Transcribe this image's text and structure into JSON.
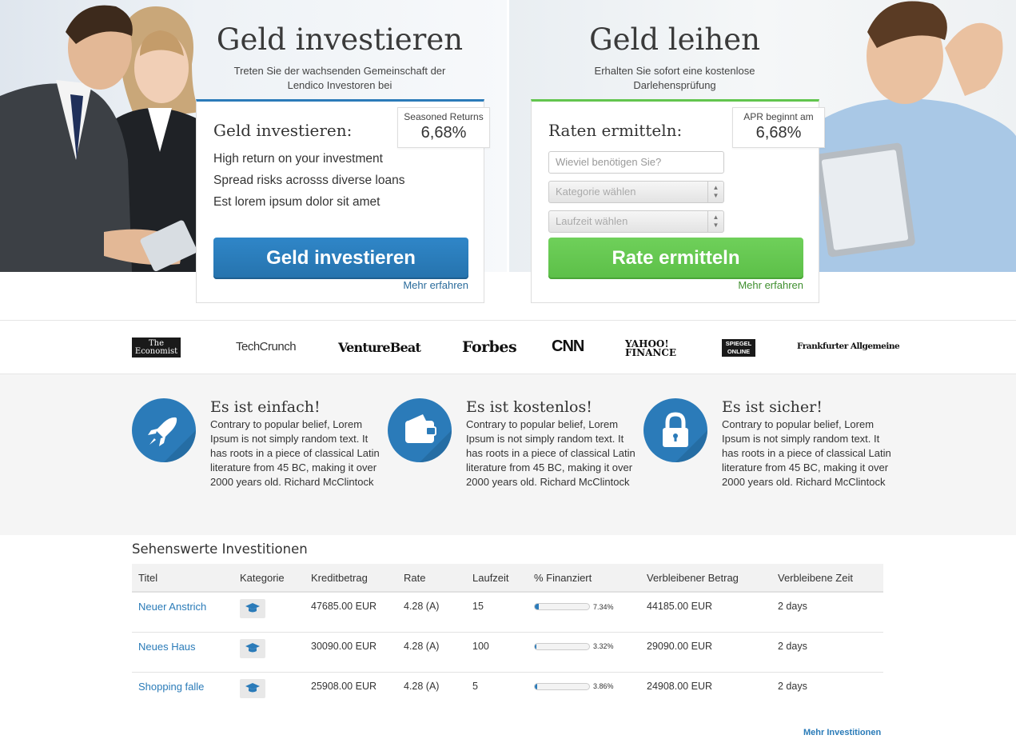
{
  "invest": {
    "hero_title": "Geld investieren",
    "hero_sub": "Treten Sie der wachsenden Gemeinschaft der Lendico Investoren bei",
    "card_title": "Geld investieren:",
    "badge_label": "Seasoned Returns",
    "badge_value": "6,68%",
    "features": [
      "High return on your investment",
      "Spread risks acrosss diverse loans",
      "Est lorem ipsum dolor sit amet"
    ],
    "button": "Geld investieren",
    "more": "Mehr erfahren"
  },
  "borrow": {
    "hero_title": "Geld leihen",
    "hero_sub": "Erhalten Sie sofort eine kostenlose Darlehensprüfung",
    "card_title": "Raten ermitteln:",
    "badge_label": "APR beginnt am",
    "badge_value": "6,68%",
    "amount_placeholder": "Wieviel benötigen Sie?",
    "category_select": "Kategorie wählen",
    "term_select": "Laufzeit wählen",
    "button": "Rate ermitteln",
    "more": "Mehr erfahren"
  },
  "press_logos": [
    "The Economist",
    "TechCrunch",
    "VentureBeat",
    "Forbes",
    "CNN",
    "YAHOO! FINANCE",
    "SPIEGEL ONLINE",
    "Frankfurter Allgemeine"
  ],
  "features": [
    {
      "title": "Es ist einfach!",
      "text": "Contrary to popular belief, Lorem Ipsum is not simply random text. It has roots in a piece of classical Latin literature from 45 BC, making it over 2000 years old. Richard McClintock",
      "icon": "rocket-icon"
    },
    {
      "title": "Es ist kostenlos!",
      "text": "Contrary to popular belief, Lorem Ipsum is not simply random text. It has roots in a piece of classical Latin literature from 45 BC, making it over 2000 years old. Richard McClintock",
      "icon": "wallet-icon"
    },
    {
      "title": "Es ist sicher!",
      "text": "Contrary to popular belief, Lorem Ipsum is not simply random text. It has roots in a piece of classical Latin literature from 45 BC, making it over 2000 years old. Richard McClintock",
      "icon": "lock-icon"
    }
  ],
  "investments": {
    "title": "Sehenswerte Investitionen",
    "columns": [
      "Titel",
      "Kategorie",
      "Kreditbetrag",
      "Rate",
      "Laufzeit",
      "% Finanziert",
      "Verbleibener Betrag",
      "Verbleibene Zeit"
    ],
    "rows": [
      {
        "title": "Neuer Anstrich",
        "category_icon": "graduation-cap-icon",
        "amount": "47685.00 EUR",
        "rate": "4.28 (A)",
        "term": "15",
        "funded_pct": 7.34,
        "funded_label": "7.34%",
        "remaining": "44185.00 EUR",
        "time_left": "2 days"
      },
      {
        "title": "Neues Haus",
        "category_icon": "graduation-cap-icon",
        "amount": "30090.00 EUR",
        "rate": "4.28 (A)",
        "term": "100",
        "funded_pct": 3.32,
        "funded_label": "3.32%",
        "remaining": "29090.00 EUR",
        "time_left": "2 days"
      },
      {
        "title": "Shopping falle",
        "category_icon": "graduation-cap-icon",
        "amount": "25908.00 EUR",
        "rate": "4.28 (A)",
        "term": "5",
        "funded_pct": 3.86,
        "funded_label": "3.86%",
        "remaining": "24908.00 EUR",
        "time_left": "2 days"
      }
    ],
    "more_link": "Mehr Investitionen"
  },
  "colors": {
    "accent_blue": "#2b7bb9",
    "accent_green": "#62c54e"
  }
}
